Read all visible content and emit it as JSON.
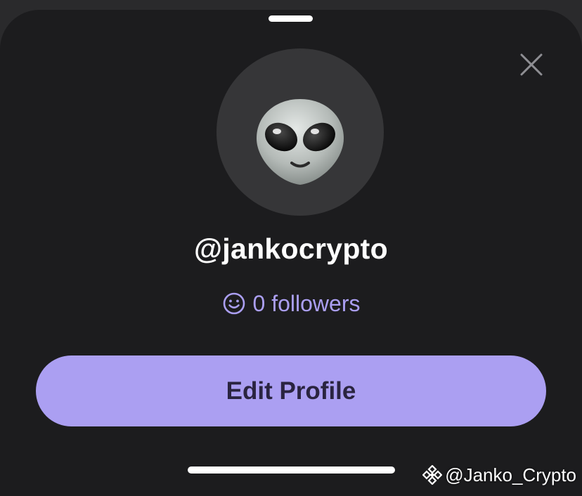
{
  "profile": {
    "handle": "@jankocrypto",
    "followers_text": "0 followers",
    "avatar_emoji": "alien-emoji"
  },
  "actions": {
    "edit_profile_label": "Edit Profile"
  },
  "icons": {
    "close": "close-icon",
    "followers": "smiley-icon",
    "watermark_logo": "binance-logo-icon"
  },
  "watermark": {
    "text": "@Janko_Crypto"
  },
  "colors": {
    "sheet_background": "#1c1c1e",
    "accent": "#ab9ff2",
    "button_text": "#2a2440",
    "avatar_background": "#363638"
  }
}
